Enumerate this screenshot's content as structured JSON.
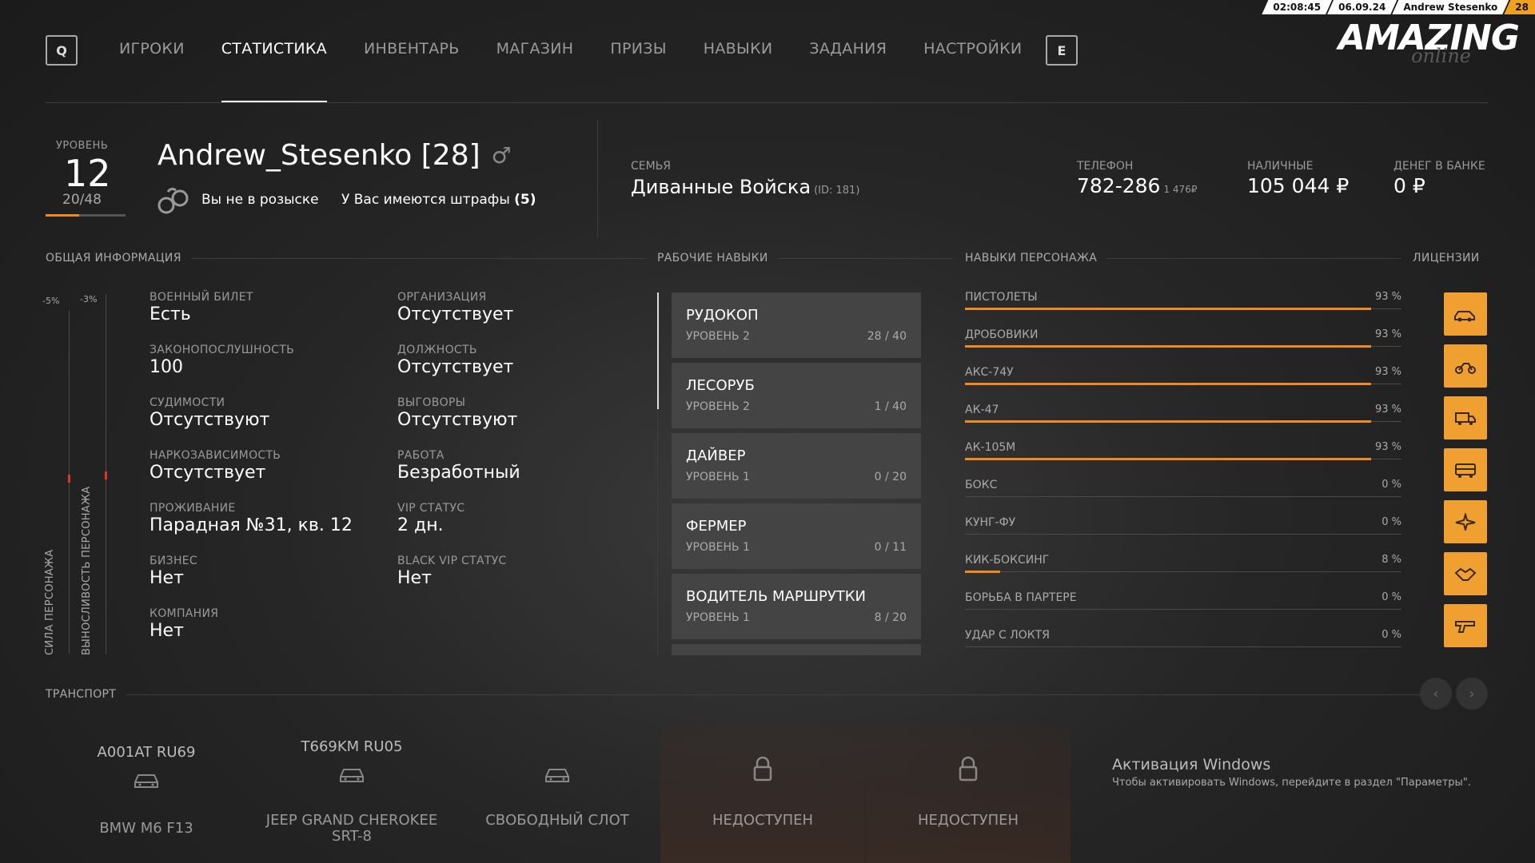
{
  "topbar": {
    "time": "02:08:45",
    "date": "06.09.24",
    "username": "Andrew Stesenko",
    "level": "28"
  },
  "nav": {
    "left_key": "Q",
    "right_key": "E",
    "tabs": [
      {
        "label": "ИГРОКИ",
        "active": false
      },
      {
        "label": "СТАТИСТИКА",
        "active": true
      },
      {
        "label": "ИНВЕНТАРЬ",
        "active": false
      },
      {
        "label": "МАГАЗИН",
        "active": false
      },
      {
        "label": "ПРИЗЫ",
        "active": false
      },
      {
        "label": "НАВЫКИ",
        "active": false
      },
      {
        "label": "ЗАДАНИЯ",
        "active": false
      },
      {
        "label": "НАСТРОЙКИ",
        "active": false
      }
    ]
  },
  "logo": {
    "main": "AMAZING",
    "sub": "online"
  },
  "profile": {
    "level_label": "УРОВЕНЬ",
    "level": "12",
    "exp": "20/48",
    "exp_progress": 0.42,
    "name": "Andrew_Stesenko [28]",
    "gender_icon": "male-icon",
    "wanted_status": "Вы не в розыске",
    "fines_text": "У Вас имеются штрафы",
    "fines_count": "(5)"
  },
  "family": {
    "label": "СЕМЬЯ",
    "name": "Диванные Войска",
    "id": "(ID: 181)"
  },
  "stats": {
    "phone_label": "ТЕЛЕФОН",
    "phone": "782-286",
    "phone_balance": "1 476₽",
    "cash_label": "НАЛИЧНЫЕ",
    "cash": "105 044 ₽",
    "bank_label": "ДЕНЕГ В БАНКЕ",
    "bank": "0 ₽"
  },
  "sections": {
    "general": "ОБЩАЯ ИНФОРМАЦИЯ",
    "jobs": "РАБОЧИЕ НАВЫКИ",
    "skills": "НАВЫКИ ПЕРСОНАЖА",
    "licenses": "ЛИЦЕНЗИИ",
    "transport": "ТРАНСПОРТ"
  },
  "bars": {
    "strength_label": "СИЛА ПЕРСОНАЖА",
    "strength_pct": "-5%",
    "stamina_label": "ВЫНОСЛИВОСТЬ ПЕРСОНАЖА",
    "stamina_pct": "-3%"
  },
  "info": {
    "left": [
      {
        "label": "ВОЕННЫЙ БИЛЕТ",
        "value": "Есть"
      },
      {
        "label": "ЗАКОНОПОСЛУШНОСТЬ",
        "value": "100"
      },
      {
        "label": "СУДИМОСТИ",
        "value": "Отсутствуют"
      },
      {
        "label": "НАРКОЗАВИСИМОСТЬ",
        "value": "Отсутствует"
      },
      {
        "label": "ПРОЖИВАНИЕ",
        "value": "Парадная №31, кв. 12"
      },
      {
        "label": "БИЗНЕС",
        "value": "Нет"
      },
      {
        "label": "КОМПАНИЯ",
        "value": "Нет"
      }
    ],
    "right": [
      {
        "label": "ОРГАНИЗАЦИЯ",
        "value": "Отсутствует"
      },
      {
        "label": "ДОЛЖНОСТЬ",
        "value": "Отсутствует"
      },
      {
        "label": "ВЫГОВОРЫ",
        "value": "Отсутствуют"
      },
      {
        "label": "РАБОТА",
        "value": "Безработный"
      },
      {
        "label": "VIP СТАТУС",
        "value": "2 дн."
      },
      {
        "label": "BLACK VIP СТАТУС",
        "value": "Нет"
      }
    ]
  },
  "jobs": [
    {
      "title": "РУДОКОП",
      "level": "УРОВЕНЬ 2",
      "progress": "28 / 40"
    },
    {
      "title": "ЛЕСОРУБ",
      "level": "УРОВЕНЬ 2",
      "progress": "1 / 40"
    },
    {
      "title": "ДАЙВЕР",
      "level": "УРОВЕНЬ 1",
      "progress": "0 / 20"
    },
    {
      "title": "ФЕРМЕР",
      "level": "УРОВЕНЬ 1",
      "progress": "0 / 11"
    },
    {
      "title": "ВОДИТЕЛЬ МАРШРУТКИ",
      "level": "УРОВЕНЬ 1",
      "progress": "8 / 20"
    }
  ],
  "skills": [
    {
      "name": "ПИСТОЛЕТЫ",
      "pct": "93 %",
      "value": 93
    },
    {
      "name": "ДРОБОВИКИ",
      "pct": "93 %",
      "value": 93
    },
    {
      "name": "АКС-74У",
      "pct": "93 %",
      "value": 93
    },
    {
      "name": "АК-47",
      "pct": "93 %",
      "value": 93
    },
    {
      "name": "АК-105М",
      "pct": "93 %",
      "value": 93
    },
    {
      "name": "БОКС",
      "pct": "0 %",
      "value": 0
    },
    {
      "name": "КУНГ-ФУ",
      "pct": "0 %",
      "value": 0
    },
    {
      "name": "КИК-БОКСИНГ",
      "pct": "8 %",
      "value": 8
    },
    {
      "name": "БОРЬБА В ПАРТЕРЕ",
      "pct": "0 %",
      "value": 0
    },
    {
      "name": "УДАР С ЛОКТЯ",
      "pct": "0 %",
      "value": 0
    }
  ],
  "licenses": [
    {
      "icon": "car-license-icon"
    },
    {
      "icon": "motorcycle-license-icon"
    },
    {
      "icon": "truck-license-icon"
    },
    {
      "icon": "bus-license-icon"
    },
    {
      "icon": "plane-license-icon"
    },
    {
      "icon": "handshake-license-icon"
    },
    {
      "icon": "gun-license-icon"
    }
  ],
  "transport": [
    {
      "plate": "A001AT RU69",
      "name": "BMW M6 F13",
      "state": "owned"
    },
    {
      "plate": "T669KM RU05",
      "name": "JEEP GRAND CHEROKEE SRT-8",
      "state": "owned"
    },
    {
      "plate": "",
      "name": "СВОБОДНЫЙ СЛОТ",
      "state": "free"
    },
    {
      "plate": "",
      "name": "НЕДОСТУПЕН",
      "state": "locked"
    },
    {
      "plate": "",
      "name": "НЕДОСТУПЕН",
      "state": "locked"
    }
  ],
  "windows": {
    "title": "Активация Windows",
    "subtitle": "Чтобы активировать Windows, перейдите в раздел \"Параметры\"."
  },
  "colors": {
    "accent": "#f08a20",
    "license_bg": "#f0a030"
  }
}
